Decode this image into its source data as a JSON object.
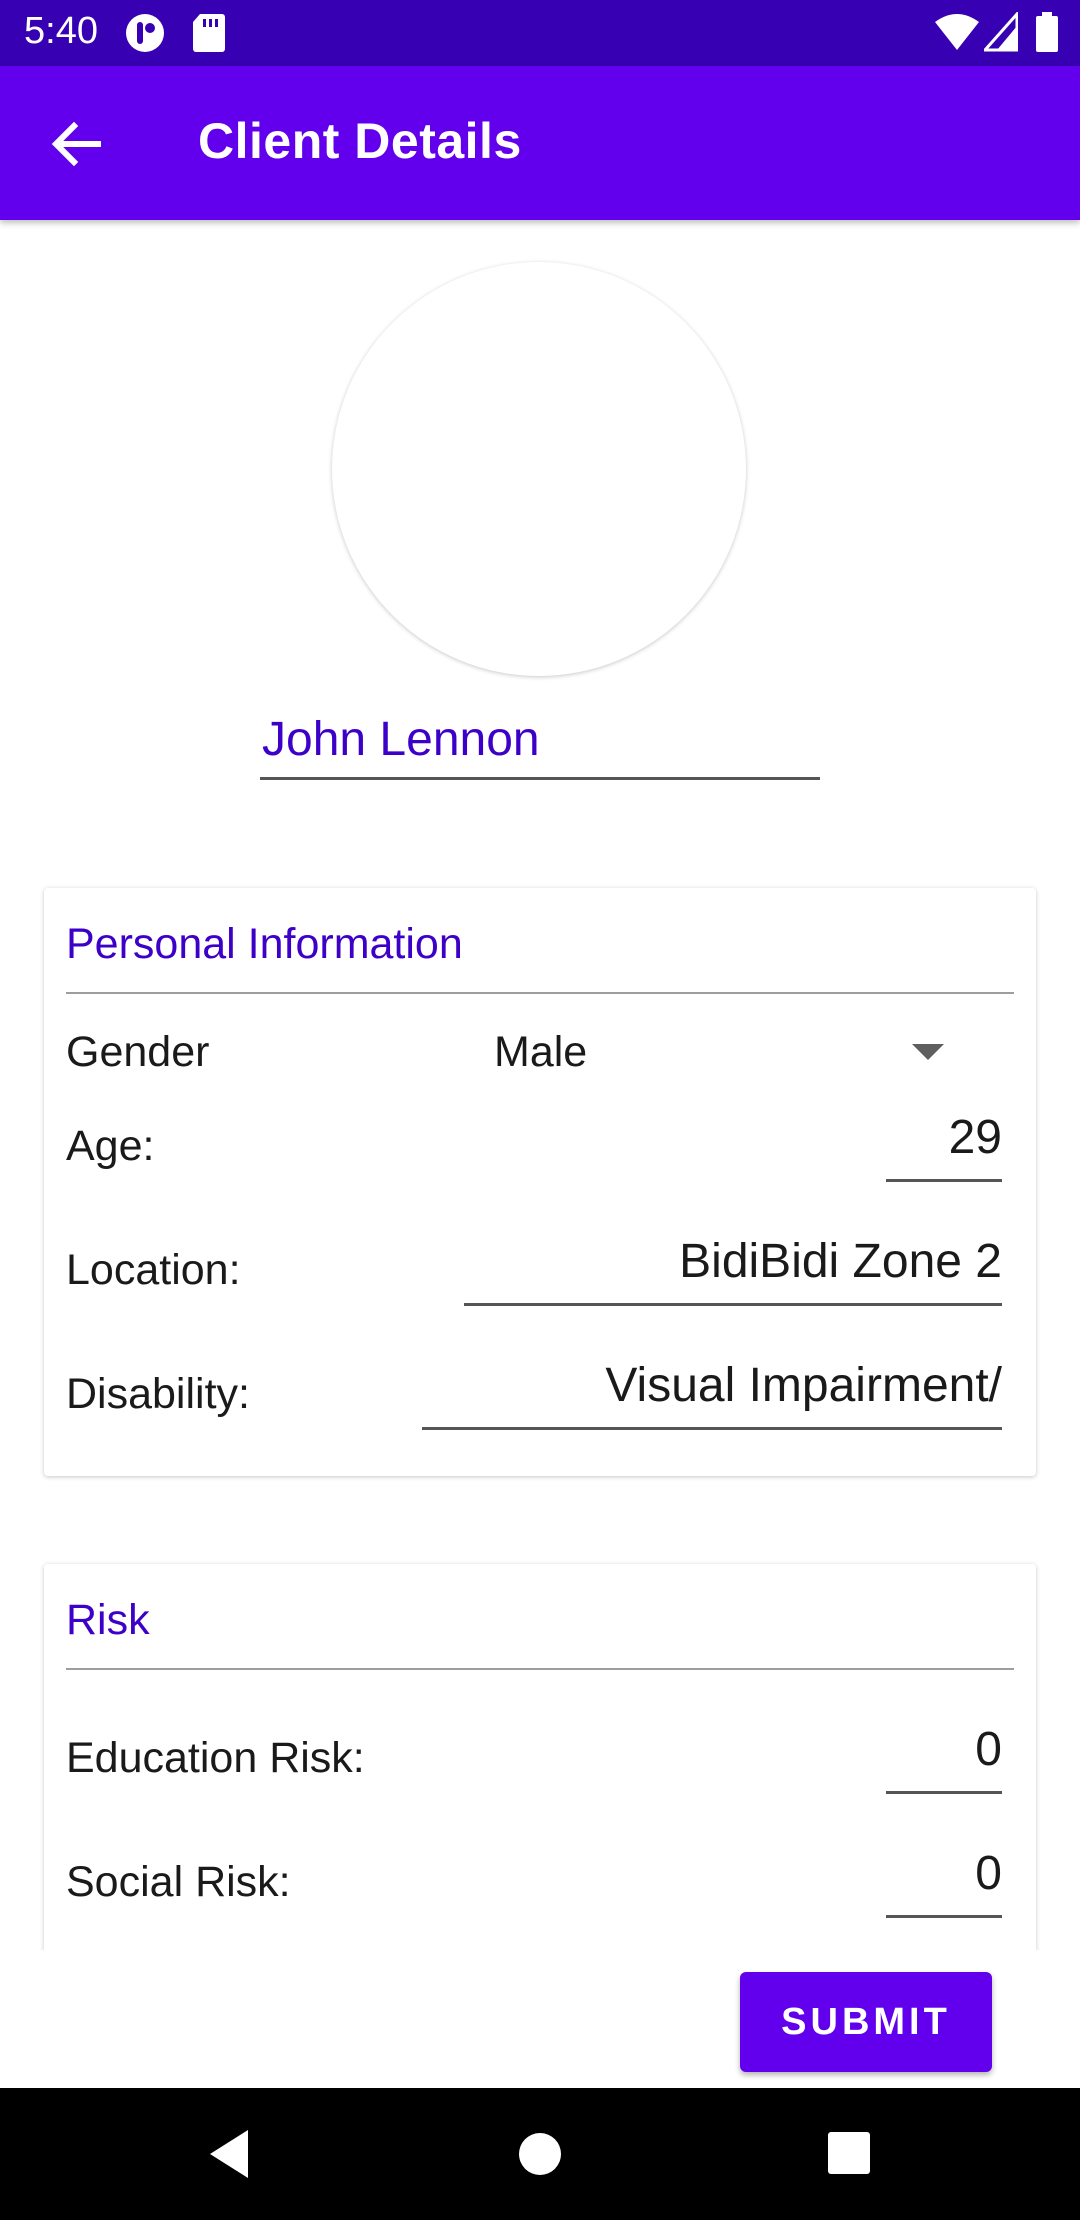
{
  "status_bar": {
    "time": "5:40",
    "icons": [
      "notification-app-icon",
      "sd-card-icon",
      "wifi-icon",
      "signal-icon",
      "battery-icon"
    ]
  },
  "app_bar": {
    "title": "Client Details",
    "back_icon": "arrow-back-icon"
  },
  "client": {
    "name": "John Lennon"
  },
  "personal_info": {
    "title": "Personal Information",
    "gender_label": "Gender",
    "gender_value": "Male",
    "age_label": "Age:",
    "age_value": "29",
    "location_label": "Location:",
    "location_value": "BidiBidi Zone 2",
    "disability_label": "Disability:",
    "disability_value": "Visual Impairment/"
  },
  "risk": {
    "title": "Risk",
    "education_label": "Education Risk:",
    "education_value": "0",
    "social_label": "Social Risk:",
    "social_value": "0"
  },
  "submit_label": "SUBMIT",
  "colors": {
    "primary": "#6200ee",
    "primary_dark": "#3700b3",
    "accent_text": "#3c00c8"
  }
}
